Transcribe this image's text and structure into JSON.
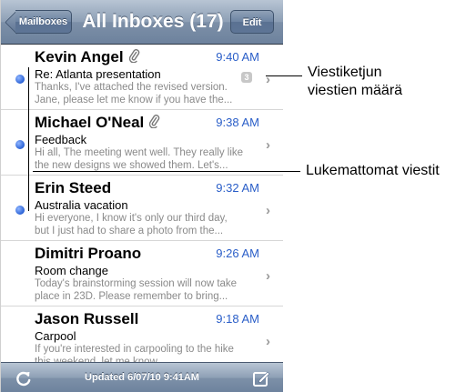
{
  "navbar": {
    "back_label": "Mailboxes",
    "title": "All Inboxes (17)",
    "edit_label": "Edit"
  },
  "messages": [
    {
      "sender": "Kevin Angel",
      "attachment": true,
      "time": "9:40 AM",
      "subject": "Re: Atlanta presentation",
      "preview": "Thanks, I've attached the revised version.\nJane, please let me know if you have the...",
      "unread": true,
      "thread_count": "3"
    },
    {
      "sender": "Michael O'Neal",
      "attachment": true,
      "time": "9:38 AM",
      "subject": "Feedback",
      "preview": "Hi all, The meeting went well. They really like\nthe new designs we showed them. Let's...",
      "unread": true
    },
    {
      "sender": "Erin Steed",
      "attachment": false,
      "time": "9:32 AM",
      "subject": "Australia vacation",
      "preview": "Hi everyone, I know it's only our third day,\nbut I just had to share a photo from the...",
      "unread": true
    },
    {
      "sender": "Dimitri Proano",
      "attachment": false,
      "time": "9:26 AM",
      "subject": "Room change",
      "preview": "Today's brainstorming session will now take\nplace in 23D. Please remember to bring...",
      "unread": false
    },
    {
      "sender": "Jason Russell",
      "attachment": false,
      "time": "9:18 AM",
      "subject": "Carpool",
      "preview": "If you're interested in carpooling to the hike\nthis weekend, let me know.",
      "unread": false
    }
  ],
  "toolbar": {
    "updated": "Updated 6/07/10 9:41AM"
  },
  "callouts": {
    "thread_count": "Viestiketjun\nviestien määrä",
    "unread": "Lukemattomat viestit"
  },
  "icons": {
    "attachment": "paperclip-icon",
    "refresh": "refresh-icon",
    "compose": "compose-icon",
    "chevron": "chevron-right-icon",
    "unread": "unread-dot-icon"
  },
  "colors": {
    "time": "#2a5ec8",
    "unread_dot": "#2a62d6",
    "navbar": "#7d90a8"
  }
}
